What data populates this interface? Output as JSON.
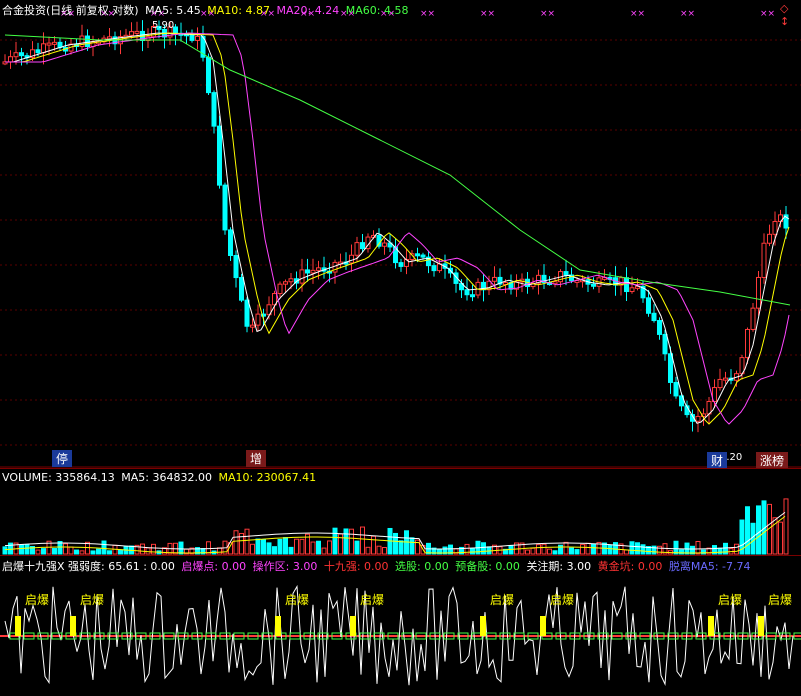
{
  "price_panel": {
    "title": "合金投资(日线 前复权 对数)",
    "ma": [
      {
        "label": "MA5: 5.45",
        "color": "#ffffff"
      },
      {
        "label": "MA10: 4.87",
        "color": "#ffff00"
      },
      {
        "label": "MA20: 4.24",
        "color": "#ff44ff"
      },
      {
        "label": "MA60: 4.58",
        "color": "#44ff44"
      }
    ],
    "high_label": "5.90",
    "low_label": "2.20",
    "badges": [
      {
        "text": "停",
        "bg": "#1a3a9a"
      },
      {
        "text": "增",
        "bg": "#7a1a1a"
      },
      {
        "text": "财",
        "bg": "#1a3a9a"
      },
      {
        "text": "涨榜",
        "bg": "#7a1a1a"
      }
    ],
    "corner": "◇ ↕"
  },
  "volume_panel": {
    "title": "VOLUME: 335864.13",
    "ma": [
      {
        "label": "MA5: 364832.00",
        "color": "#ffffff"
      },
      {
        "label": "MA10: 230067.41",
        "color": "#ffff00"
      }
    ]
  },
  "indicator_panel": {
    "title": "启爆十九强X 强弱度: 65.61 : 0.00",
    "items": [
      {
        "label": "启爆点: 0.00",
        "color": "#ff44ff"
      },
      {
        "label": "操作区: 3.00",
        "color": "#ff44ff"
      },
      {
        "label": "十九强: 0.00",
        "color": "#ff3333"
      },
      {
        "label": "选股: 0.00",
        "color": "#44ff44"
      },
      {
        "label": "预备股: 0.00",
        "color": "#44ff44"
      },
      {
        "label": "关注期: 3.00",
        "color": "#ffffff"
      },
      {
        "label": "黄金坑: 0.00",
        "color": "#ff3333"
      },
      {
        "label": "脱离MA5: -7.74",
        "color": "#6a6aff"
      }
    ],
    "signal_label": "启爆",
    "signal_count": 9
  },
  "chart_data": {
    "type": "candlestick",
    "price_labels": [
      "5.90",
      "2.20"
    ]
  }
}
